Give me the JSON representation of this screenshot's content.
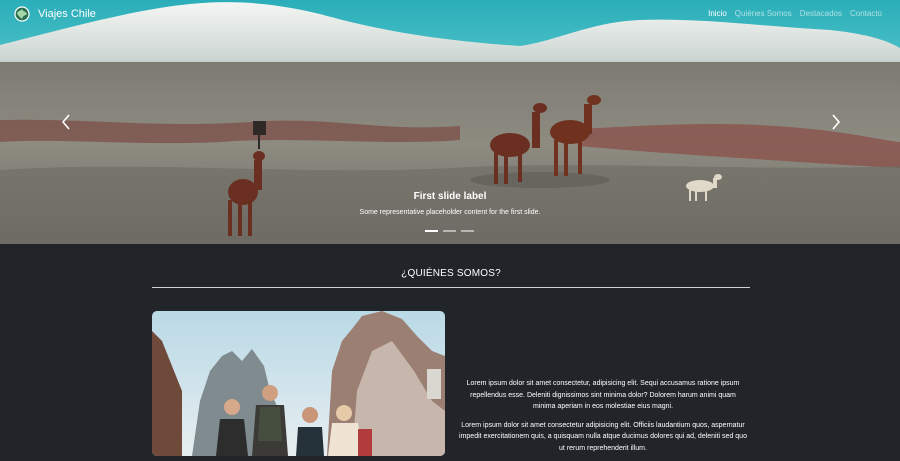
{
  "brand": {
    "name": "Viajes Chile",
    "logo_icon": "globe-logo-icon"
  },
  "nav": {
    "items": [
      {
        "label": "Inicio",
        "active": true
      },
      {
        "label": "Quiénes Somos",
        "active": false
      },
      {
        "label": "Destacados",
        "active": false
      },
      {
        "label": "Contacto",
        "active": false
      }
    ]
  },
  "carousel": {
    "caption_title": "First slide label",
    "caption_text": "Some representative placeholder content for the first slide.",
    "prev_icon": "chevron-left-icon",
    "next_icon": "chevron-right-icon",
    "slide_count": 3,
    "active_slide": 1
  },
  "about": {
    "title": "¿QUIÉNES SOMOS?",
    "paragraphs": [
      "Lorem ipsum dolor sit amet consectetur, adipisicing elit. Sequi accusamus ratione ipsum repellendus esse. Deleniti dignissimos sint minima dolor? Dolorem harum animi quam minima aperiam in eos molestiae eius magni.",
      "Lorem ipsum dolor sit amet consectetur adipisicing elit. Officiis laudantium quos, aspernatur impedit exercitationem quis, a quisquam nulla atque ducimus dolores qui ad, deleniti sed quo ut rerum reprehenderit illum."
    ]
  },
  "colors": {
    "page_background": "#212529",
    "sky": "#39b8c2",
    "nav_active": "#ffffff",
    "nav_inactive": "#c4c9cc"
  }
}
